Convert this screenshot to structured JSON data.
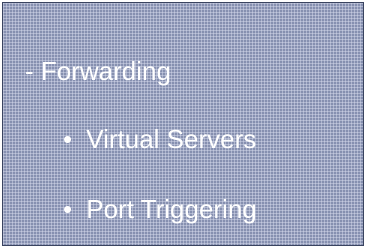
{
  "slide": {
    "heading": "- Forwarding",
    "items": [
      {
        "bullet": "•",
        "label": "Virtual Servers"
      },
      {
        "bullet": "•",
        "label": "Port Triggering"
      }
    ]
  },
  "colors": {
    "background": "#8690b0",
    "text": "#ffffff"
  }
}
